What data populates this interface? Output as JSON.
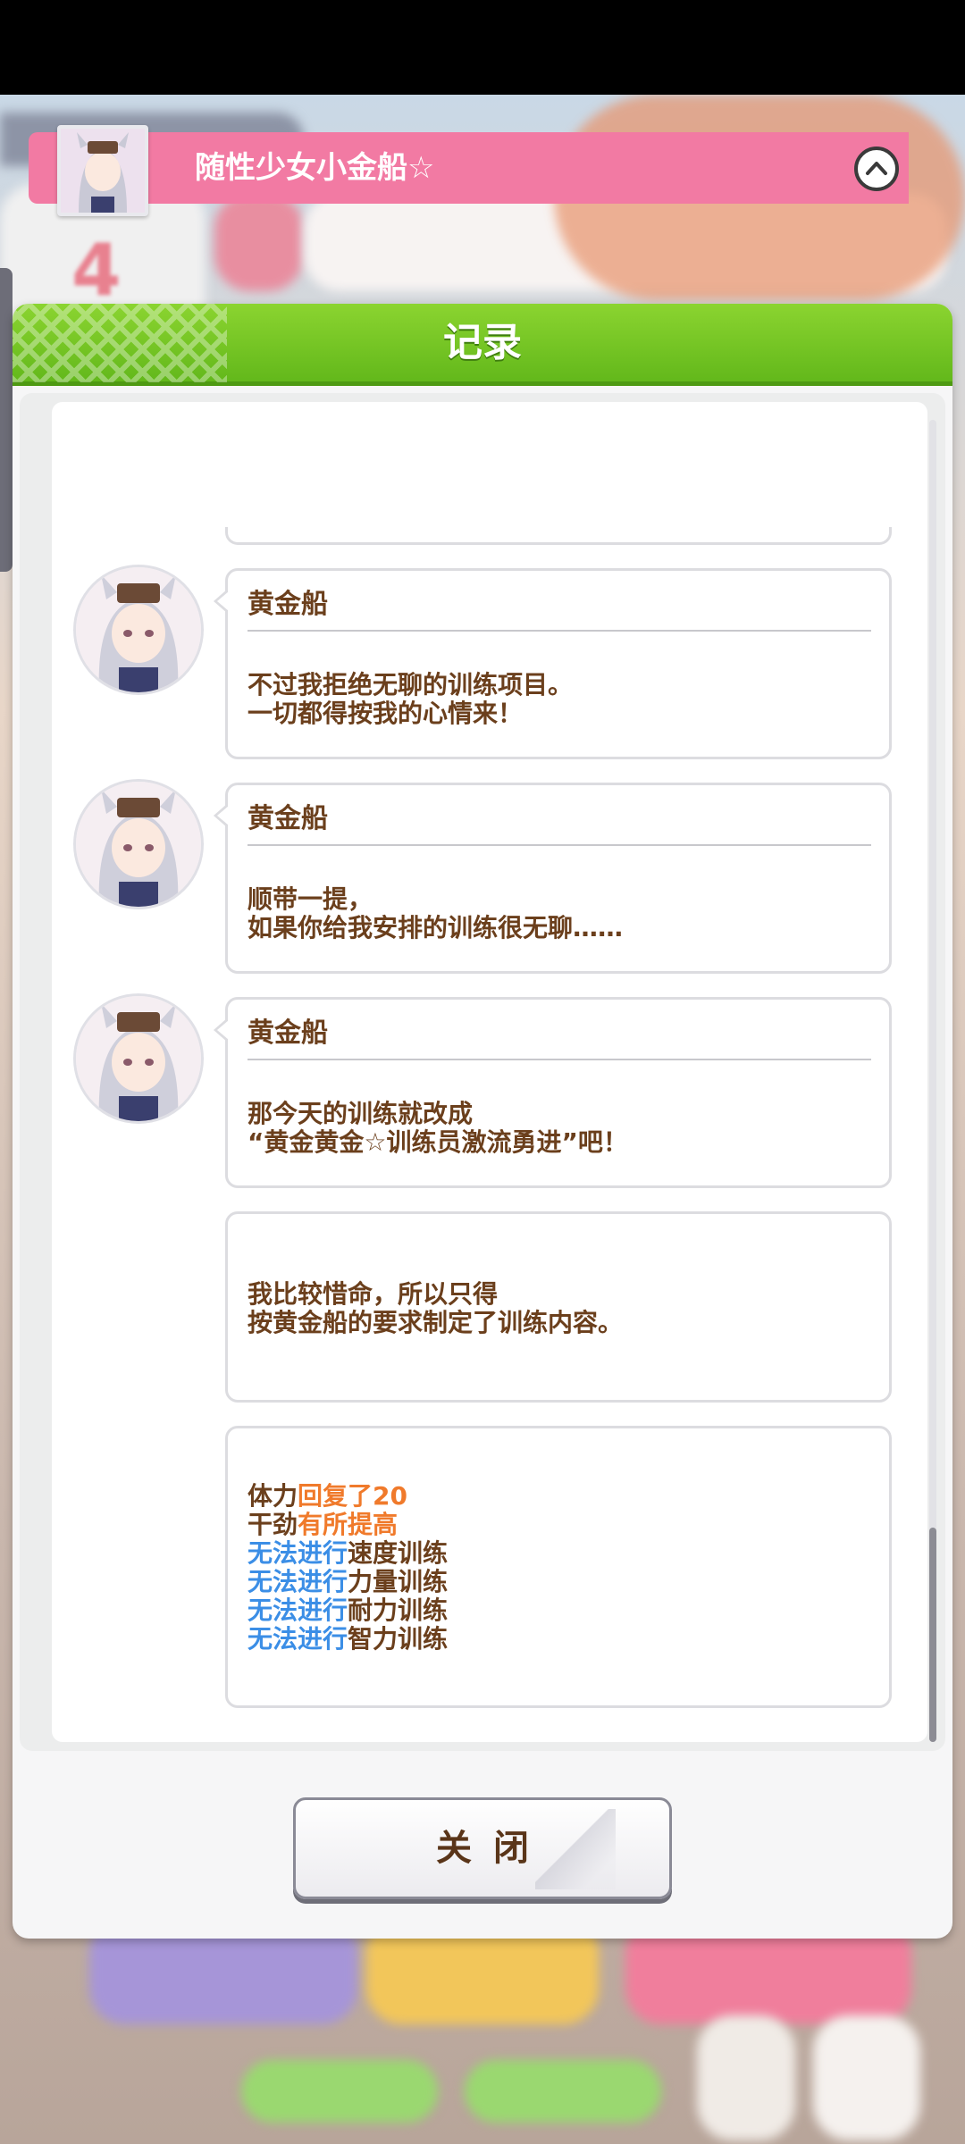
{
  "dialog": {
    "title": "记录",
    "close_label": "关闭",
    "character_name": "随性少女小金船☆"
  },
  "background": {
    "calendar_number": "4"
  },
  "messages": [
    {
      "speaker": "黄金船",
      "text": "不过我拒绝无聊的训练项目。\n一切都得按我的心情来！"
    },
    {
      "speaker": "黄金船",
      "text": "顺带一提，\n如果你给我安排的训练很无聊……"
    },
    {
      "speaker": "黄金船",
      "text": "那今天的训练就改成\n“黄金黄金☆训练员激流勇进”吧！"
    },
    {
      "speaker": "",
      "text": "我比较惜命，所以只得\n按黄金船的要求制定了训练内容。"
    }
  ],
  "effects": [
    {
      "a": "体力",
      "b": "回复了20",
      "b_color": "orange"
    },
    {
      "a": "干劲",
      "b": "有所提高",
      "b_color": "orange"
    },
    {
      "a_blue": "无法进行",
      "c": "速度训练"
    },
    {
      "a_blue": "无法进行",
      "c": "力量训练"
    },
    {
      "a_blue": "无法进行",
      "c": "耐力训练"
    },
    {
      "a_blue": "无法进行",
      "c": "智力训练"
    }
  ],
  "colors": {
    "header_green": "#6cc021",
    "character_bar_pink": "#f27aa3",
    "text_brown": "#6b3f1c",
    "effect_orange": "#f07a2b",
    "effect_blue": "#3b8ee6"
  }
}
